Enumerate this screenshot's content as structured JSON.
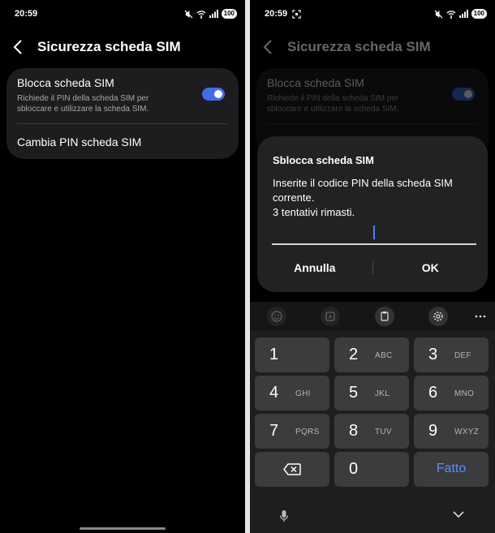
{
  "status": {
    "time": "20:59",
    "battery": "100"
  },
  "screen": {
    "title": "Sicurezza scheda SIM",
    "lock_sim": {
      "title": "Blocca scheda SIM",
      "subtitle": "Richiede il PIN della scheda SIM per sbloccare e utilizzare la scheda SIM.",
      "enabled": true
    },
    "change_pin": "Cambia PIN scheda SIM"
  },
  "dialog": {
    "title": "Sblocca scheda SIM",
    "message_line1": "Inserite il codice PIN della scheda SIM corrente.",
    "message_line2": "3 tentativi rimasti.",
    "pin_value": "",
    "cancel": "Annulla",
    "ok": "OK"
  },
  "keyboard": {
    "keys": [
      {
        "num": "1",
        "letters": ""
      },
      {
        "num": "2",
        "letters": "ABC"
      },
      {
        "num": "3",
        "letters": "DEF"
      },
      {
        "num": "4",
        "letters": "GHI"
      },
      {
        "num": "5",
        "letters": "JKL"
      },
      {
        "num": "6",
        "letters": "MNO"
      },
      {
        "num": "7",
        "letters": "PQRS"
      },
      {
        "num": "8",
        "letters": "TUV"
      },
      {
        "num": "9",
        "letters": "WXYZ"
      }
    ],
    "zero": "0",
    "done": "Fatto",
    "toolbar_icons": [
      "emoji-icon",
      "sticker-icon",
      "clipboard-icon",
      "settings-icon",
      "more-icon"
    ]
  },
  "colors": {
    "accent": "#3e6de6",
    "done_text": "#5b8dfa",
    "card": "#1d1d1f",
    "dialog": "#222224",
    "key": "#3c3c3e"
  }
}
